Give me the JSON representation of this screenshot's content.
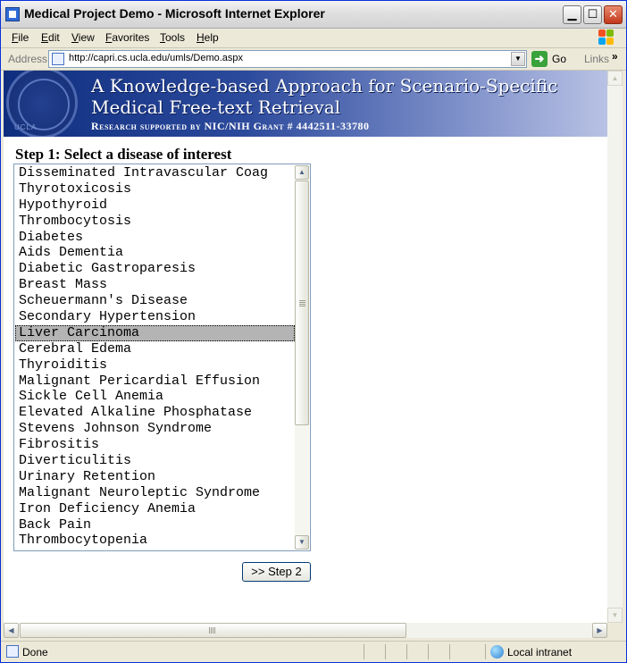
{
  "window": {
    "title": "Medical Project Demo - Microsoft Internet Explorer"
  },
  "menu": {
    "items": [
      "File",
      "Edit",
      "View",
      "Favorites",
      "Tools",
      "Help"
    ]
  },
  "address": {
    "label": "Address",
    "url": "http://capri.cs.ucla.edu/umls/Demo.aspx",
    "go_label": "Go",
    "links_label": "Links",
    "links_chevron": "»"
  },
  "banner": {
    "title_line1": "A Knowledge-based Approach for Scenario-Specific",
    "title_line2": "Medical Free-text Retrieval",
    "subtitle": "Research supported by NIC/NIH Grant # 4442511-33780",
    "seal_text": "UCLA"
  },
  "step1": {
    "heading": "Step 1: Select a disease of interest",
    "selected_index": 10,
    "options": [
      "Disseminated Intravascular Coag",
      "Thyrotoxicosis",
      "Hypothyroid",
      "Thrombocytosis",
      "Diabetes",
      "Aids Dementia",
      "Diabetic Gastroparesis",
      "Breast Mass",
      "Scheuermann's Disease",
      "Secondary Hypertension",
      "Liver Carcinoma",
      "Cerebral Edema",
      "Thyroiditis",
      "Malignant Pericardial Effusion",
      "Sickle Cell Anemia",
      "Elevated Alkaline Phosphatase",
      "Stevens Johnson Syndrome",
      "Fibrositis",
      "Diverticulitis",
      "Urinary Retention",
      "Malignant Neuroleptic Syndrome",
      "Iron Deficiency Anemia",
      "Back Pain",
      "Thrombocytopenia"
    ],
    "button_label": ">> Step 2"
  },
  "status": {
    "text": "Done",
    "zone": "Local intranet"
  },
  "colors": {
    "selection": "#b4b4b4",
    "banner_dark": "#0f2e7e",
    "banner_light": "#b9c2e4",
    "border": "#7f9db9"
  },
  "icons": {
    "app": "ie-page-icon",
    "minimize": "minimize-icon",
    "maximize": "maximize-icon",
    "close": "close-icon",
    "logo": "windows-logo-icon",
    "go": "go-arrow-icon",
    "zone": "globe-icon"
  }
}
